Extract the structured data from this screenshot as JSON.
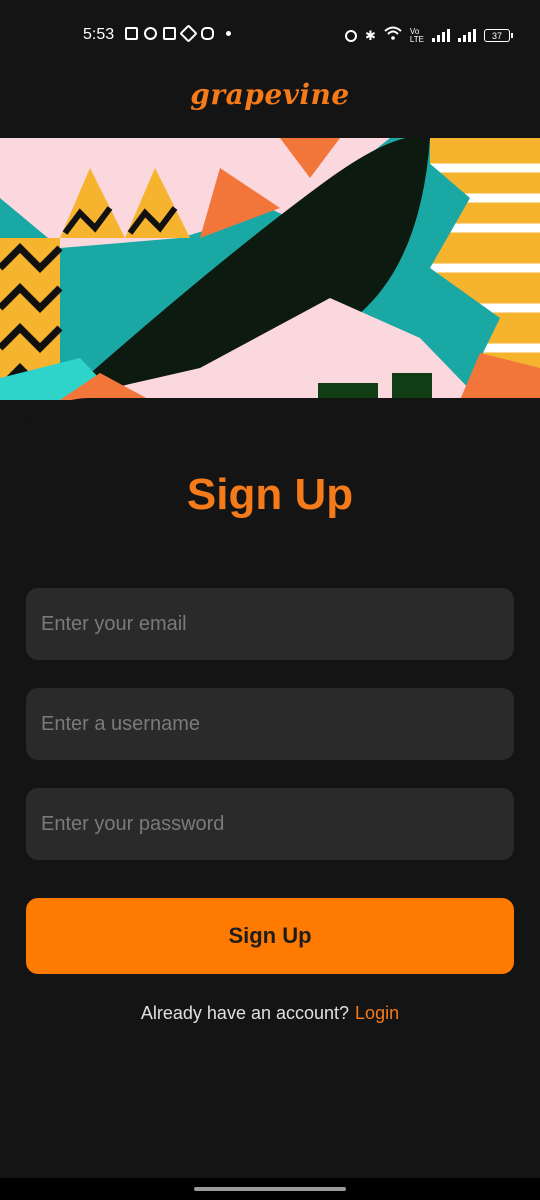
{
  "status_bar": {
    "time": "5:53",
    "battery": "37",
    "left_icons": [
      "news-icon",
      "snapchat-icon",
      "linkedin-icon",
      "slack-icon",
      "discord-icon",
      "dot-icon"
    ],
    "right_icons": [
      "alarm-icon",
      "bluetooth-icon",
      "wifi-icon",
      "volte-icon",
      "signal-icon",
      "signal-icon",
      "battery-icon"
    ]
  },
  "app": {
    "logo_text": "grapevine",
    "brand_color": "#f47a1a"
  },
  "signup": {
    "title": "Sign Up",
    "email_placeholder": "Enter your email",
    "email_value": "",
    "username_placeholder": "Enter a username",
    "username_value": "",
    "password_placeholder": "Enter your password",
    "password_value": "",
    "submit_label": "Sign Up",
    "footer_text": "Already have an account?",
    "login_link": "Login"
  },
  "colors": {
    "background": "#141414",
    "input_bg": "#2a2a2a",
    "button_bg": "#ff7a00",
    "accent": "#f47a1a"
  }
}
